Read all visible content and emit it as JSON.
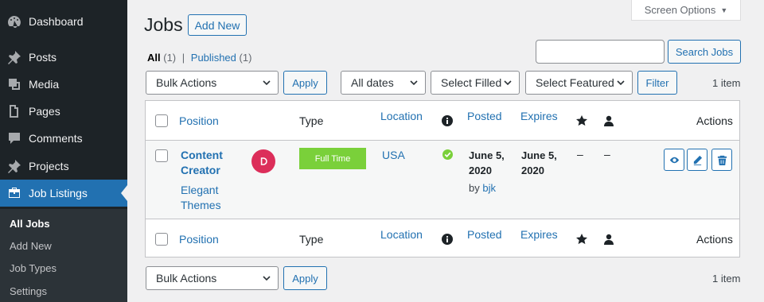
{
  "sidebar": {
    "items": [
      {
        "label": "Dashboard",
        "icon": "dashboard-icon"
      },
      {
        "label": "Posts",
        "icon": "pin-icon"
      },
      {
        "label": "Media",
        "icon": "media-icon"
      },
      {
        "label": "Pages",
        "icon": "pages-icon"
      },
      {
        "label": "Comments",
        "icon": "comment-icon"
      },
      {
        "label": "Projects",
        "icon": "pin-icon"
      },
      {
        "label": "Job Listings",
        "icon": "briefcase-icon"
      }
    ],
    "submenu": [
      "All Jobs",
      "Add New",
      "Job Types",
      "Settings"
    ]
  },
  "header": {
    "title": "Jobs",
    "add_new": "Add New",
    "screen_options": "Screen Options"
  },
  "views": {
    "all": "All",
    "all_count": "(1)",
    "sep": "|",
    "published": "Published",
    "published_count": "(1)"
  },
  "search": {
    "button": "Search Jobs",
    "value": ""
  },
  "filters": {
    "bulk_actions": "Bulk Actions",
    "apply": "Apply",
    "dates": "All dates",
    "filled": "Select Filled",
    "featured": "Select Featured",
    "filter": "Filter"
  },
  "item_count": "1 item",
  "table": {
    "columns": {
      "position": "Position",
      "type": "Type",
      "location": "Location",
      "posted": "Posted",
      "expires": "Expires",
      "actions": "Actions"
    },
    "row": {
      "title_line1": "Content",
      "title_line2": "Creator",
      "company_line1": "Elegant",
      "company_line2": "Themes",
      "type": "Full Time",
      "location": "USA",
      "posted_line1": "June 5,",
      "posted_line2": "2020",
      "posted_by": "by",
      "author": "bjk",
      "expires_line1": "June 5,",
      "expires_line2": "2020",
      "featured": "–",
      "filled": "–"
    }
  },
  "colors": {
    "sidebar_bg": "#1d2327",
    "accent": "#2271b1",
    "fulltime_badge": "#7ad03a",
    "status_ok": "#7ad03a",
    "company_logo": "#dc2e5a"
  }
}
